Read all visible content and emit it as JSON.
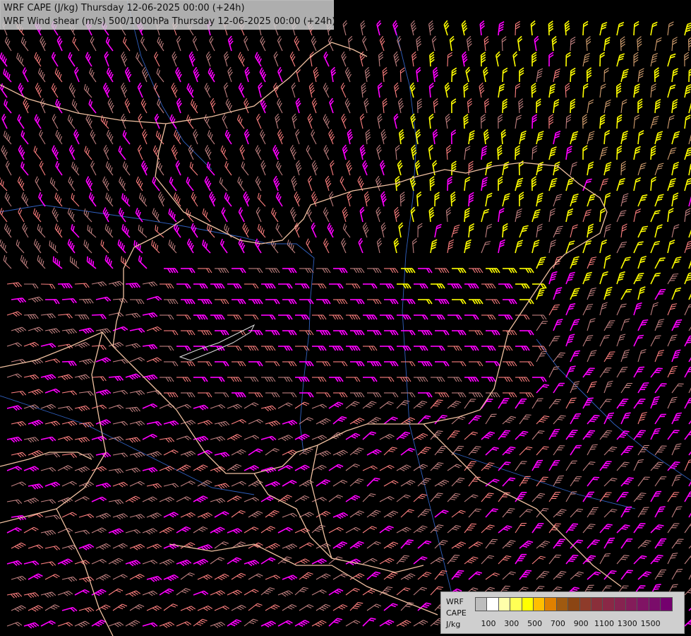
{
  "header": {
    "line1": "WRF CAPE (J/kg) Thursday 12-06-2025 00:00 (+24h)",
    "line2": "WRF Wind shear (m/s) 500/1000hPa Thursday 12-06-2025 00:00 (+24h)"
  },
  "legend": {
    "label1": "WRF",
    "label2": "CAPE",
    "label3": "J/kg",
    "colors": [
      "#bdbdbd",
      "#ffffff",
      "#ffffaa",
      "#ffff55",
      "#ffff00",
      "#ffbf00",
      "#e08000",
      "#a05a10",
      "#8b4513",
      "#8e3b2a",
      "#8a2f3a",
      "#8a2846",
      "#862350",
      "#841c5a",
      "#801464",
      "#7a0c6a",
      "#74006e"
    ],
    "tick_labels": [
      "100",
      "300",
      "500",
      "700",
      "900",
      "1100",
      "1300",
      "1500"
    ]
  },
  "map_layers": {
    "barb_colors": {
      "weak": "#c08080",
      "moderate": "#ff8080",
      "strong": "#ff00ff",
      "high_cape": "#ffff00",
      "tan": "#d4a070"
    },
    "border_color": "#f0c0a0",
    "river_color": "#3060c0"
  }
}
